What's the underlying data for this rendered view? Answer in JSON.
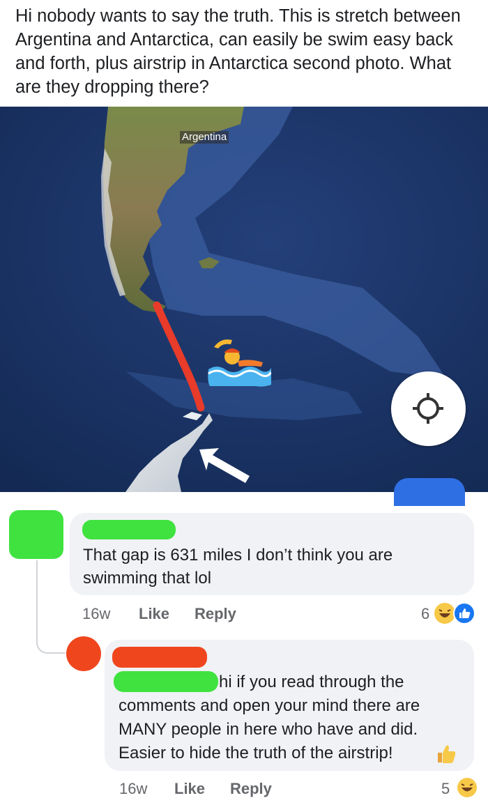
{
  "post": {
    "text": "Hi nobody wants to say the truth. This is stretch between Argentina and Antarctica, can easily be swim easy back and forth, plus airstrip in Antarctica second photo. What are they dropping there?"
  },
  "map": {
    "label": "Argentina",
    "swimmer_emoji": "🏊",
    "icons": [
      "swimmer-icon",
      "arrow-icon",
      "locate-icon"
    ]
  },
  "comments": [
    {
      "text": "That gap is 631 miles I don’t think you are swimming that lol",
      "time": "16w",
      "like_label": "Like",
      "reply_label": "Reply",
      "reaction_count": "6",
      "avatar_color": "#3fe23f",
      "name_bar_color": "#3fe23f"
    },
    {
      "text_lines": [
        "hi if you read through the",
        "comments and open your mind there are",
        "MANY people in here who have and did.",
        "Easier to hide the truth of the airstrip!"
      ],
      "thumb_emoji": "👍",
      "time": "16w",
      "like_label": "Like",
      "reply_label": "Reply",
      "reaction_count": "5",
      "avatar_color": "#f0461e",
      "name_bar_color": "#f0461e",
      "mention_bar_color": "#3fe23f"
    }
  ]
}
